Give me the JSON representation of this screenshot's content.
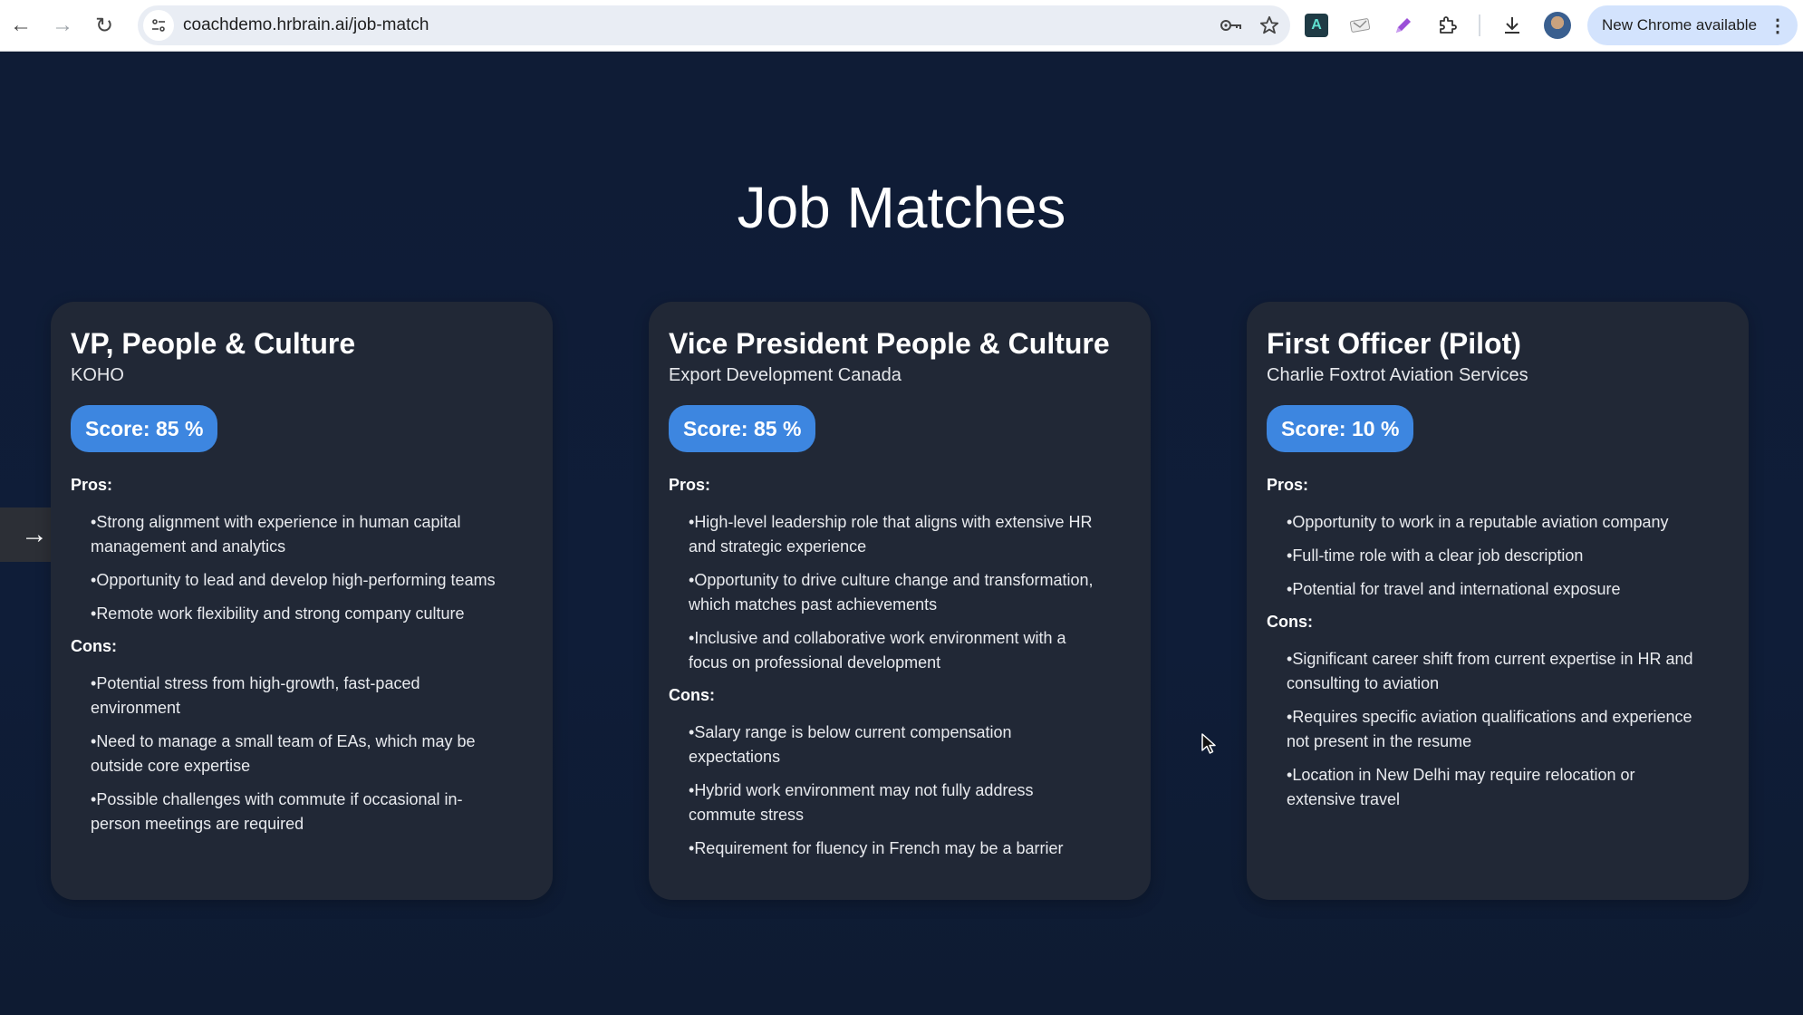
{
  "browser": {
    "url": "coachdemo.hrbrain.ai/job-match",
    "nav": {
      "back": "←",
      "forward": "→",
      "reload": "↻"
    },
    "omnibox_icons": [
      "password-key-icon",
      "bookmark-star-icon"
    ],
    "extensions": [
      "a-extension",
      "mail-extension",
      "pen-extension",
      "puzzle-extension"
    ],
    "download_icon": "⤓",
    "new_chrome_label": "New Chrome available",
    "menu_glyph": "⋮"
  },
  "page": {
    "title": "Job Matches",
    "side_arrow": "→",
    "pros_label": "Pros:",
    "cons_label": "Cons:"
  },
  "jobs": [
    {
      "title": "VP, People & Culture",
      "company": "KOHO",
      "score_label": "Score: 85 %",
      "score": 85,
      "pros": [
        "Strong alignment with experience in human capital management and analytics",
        "Opportunity to lead and develop high-performing teams",
        "Remote work flexibility and strong company culture"
      ],
      "cons": [
        "Potential stress from high-growth, fast-paced environment",
        "Need to manage a small team of EAs, which may be outside core expertise",
        "Possible challenges with commute if occasional in-person meetings are required"
      ]
    },
    {
      "title": "Vice President People & Culture",
      "company": "Export Development Canada",
      "score_label": "Score: 85 %",
      "score": 85,
      "pros": [
        "High-level leadership role that aligns with extensive HR and strategic experience",
        "Opportunity to drive culture change and transformation, which matches past achievements",
        "Inclusive and collaborative work environment with a focus on professional development"
      ],
      "cons": [
        "Salary range is below current compensation expectations",
        "Hybrid work environment may not fully address commute stress",
        "Requirement for fluency in French may be a barrier"
      ]
    },
    {
      "title": "First Officer (Pilot)",
      "company": "Charlie Foxtrot Aviation Services",
      "score_label": "Score: 10 %",
      "score": 10,
      "pros": [
        "Opportunity to work in a reputable aviation company",
        "Full-time role with a clear job description",
        "Potential for travel and international exposure"
      ],
      "cons": [
        "Significant career shift from current expertise in HR and consulting to aviation",
        "Requires specific aviation qualifications and experience not present in the resume",
        "Location in New Delhi may require relocation or extensive travel"
      ]
    }
  ],
  "colors": {
    "background": "#0f1c36",
    "card": "#212836",
    "score_pill": "#3d86e0",
    "new_chrome_pill": "#d3e3fd"
  }
}
